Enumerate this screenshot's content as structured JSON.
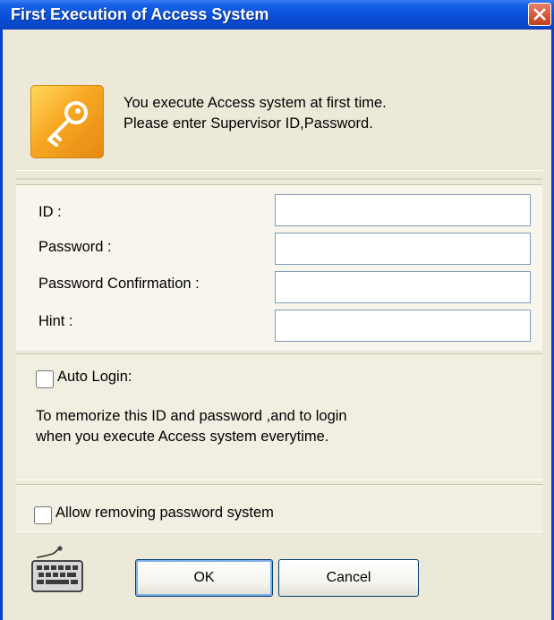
{
  "window": {
    "title": "First Execution of Access System"
  },
  "intro": {
    "line1": "You execute Access system at first time.",
    "line2": "Please enter Supervisor ID,Password."
  },
  "fields": [
    {
      "label": "ID :",
      "value": ""
    },
    {
      "label": "Password :",
      "value": ""
    },
    {
      "label": "Password Confirmation :",
      "value": ""
    },
    {
      "label": "Hint :",
      "value": ""
    }
  ],
  "auto_login": {
    "label": "Auto Login:",
    "checked": false,
    "description_line1": "To memorize this ID and password ,and to login",
    "description_line2": "when you execute Access system everytime."
  },
  "allow_remove": {
    "label": "Allow removing password system",
    "checked": false
  },
  "buttons": {
    "ok": "OK",
    "cancel": "Cancel"
  },
  "icons": {
    "header": "key-icon",
    "footer": "keyboard-icon",
    "close": "close-icon"
  },
  "colors": {
    "titlebar": "#0A48CC",
    "close_button": "#D45737",
    "dialog_bg": "#ECE9D8",
    "key_icon": "#F7A823"
  }
}
